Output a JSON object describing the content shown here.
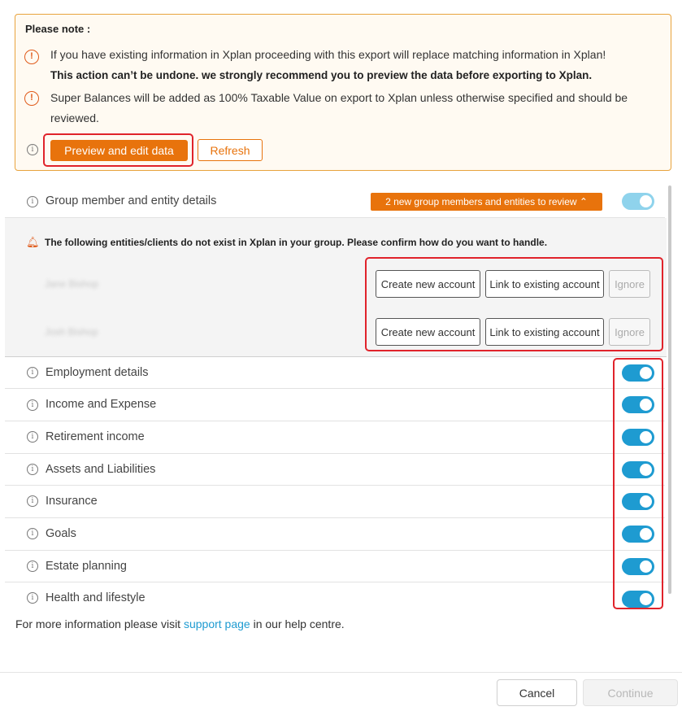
{
  "notice": {
    "title": "Please note :",
    "line1": "If you have existing information in Xplan proceeding with this export will replace matching information in Xplan!",
    "line1_bold": "This action can’t be undone. we strongly recommend you to preview the data before exporting to Xplan.",
    "line2": "Super Balances will be added as 100% Taxable Value on export to Xplan unless otherwise specified and should be",
    "line2_cont": "reviewed.",
    "preview_label": "Preview and edit data",
    "refresh_label": "Refresh"
  },
  "group": {
    "label": "Group member and entity details",
    "badge": "2 new group members and entities to review ⌃",
    "enabled": true
  },
  "entities": {
    "note": "The following entities/clients do not exist in Xplan in your group. Please confirm how do you want to handle.",
    "rows": [
      {
        "name": "Jane Bishop",
        "create": "Create new account",
        "link": "Link to existing account",
        "ignore": "Ignore"
      },
      {
        "name": "Josh Bishop",
        "create": "Create new account",
        "link": "Link to existing account",
        "ignore": "Ignore"
      }
    ]
  },
  "sections": [
    {
      "label": "Employment details",
      "enabled": true
    },
    {
      "label": "Income and Expense",
      "enabled": true
    },
    {
      "label": "Retirement income",
      "enabled": true
    },
    {
      "label": "Assets and Liabilities",
      "enabled": true
    },
    {
      "label": "Insurance",
      "enabled": true
    },
    {
      "label": "Goals",
      "enabled": true
    },
    {
      "label": "Estate planning",
      "enabled": true
    },
    {
      "label": "Health and lifestyle",
      "enabled": true
    }
  ],
  "footer": {
    "prefix": "For more information please visit",
    "link": "support page",
    "suffix": "in our help centre."
  },
  "actions": {
    "cancel": "Cancel",
    "continue": "Continue"
  },
  "colors": {
    "accent": "#e8730c",
    "toggle": "#1e9bd1",
    "warning": "#e05a1a",
    "highlight": "#e0232b"
  }
}
